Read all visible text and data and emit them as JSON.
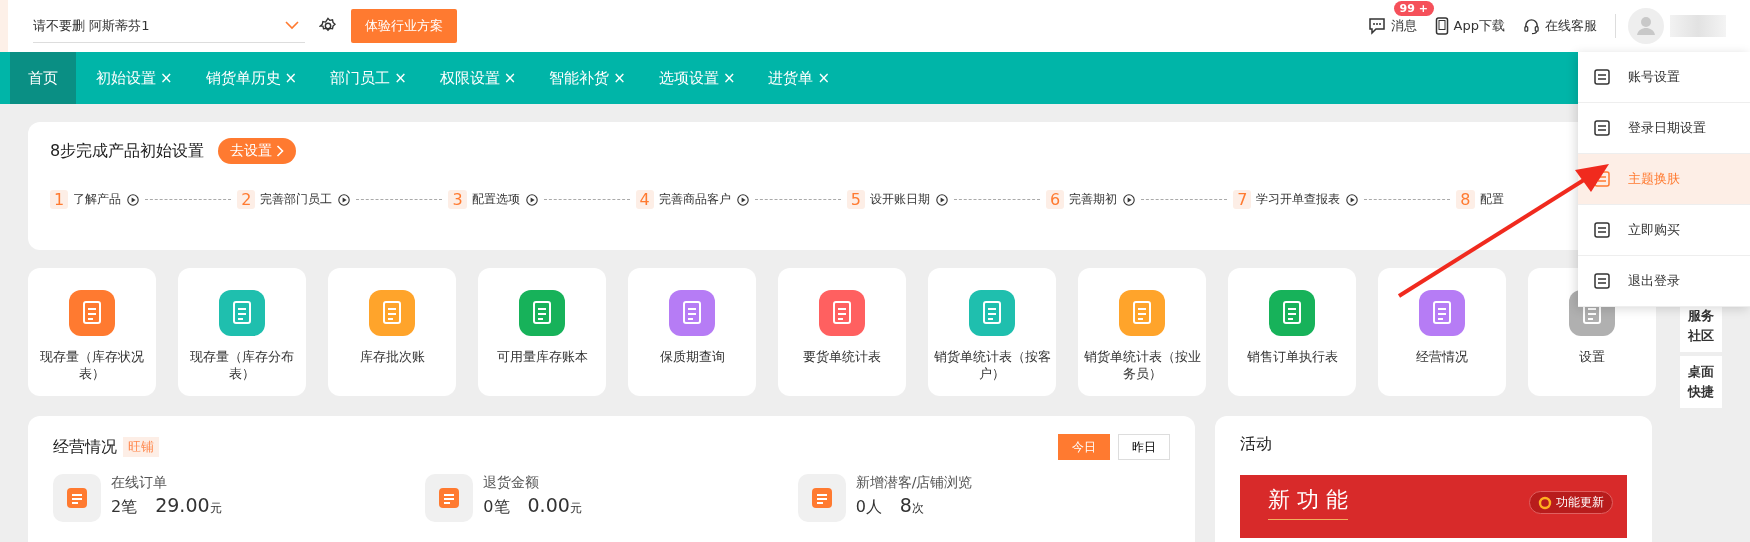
{
  "header": {
    "company": "请不要删 阿斯蒂芬1",
    "trial_button": "体验行业方案",
    "messages": {
      "label": "消息",
      "badge": "99 +"
    },
    "app_download": "App下载",
    "support": "在线客服"
  },
  "tabs": [
    {
      "label": "首页",
      "selected": true,
      "closable": false
    },
    {
      "label": "初始设置",
      "selected": false,
      "closable": true
    },
    {
      "label": "销货单历史",
      "selected": false,
      "closable": true
    },
    {
      "label": "部门员工",
      "selected": false,
      "closable": true
    },
    {
      "label": "权限设置",
      "selected": false,
      "closable": true
    },
    {
      "label": "智能补货",
      "selected": false,
      "closable": true
    },
    {
      "label": "选项设置",
      "selected": false,
      "closable": true
    },
    {
      "label": "进货单",
      "selected": false,
      "closable": true
    }
  ],
  "close_glyph": "×",
  "setup": {
    "title": "8步完成产品初始设置",
    "button": "去设置",
    "steps": [
      {
        "number": "1",
        "label": "了解产品"
      },
      {
        "number": "2",
        "label": "完善部门员工"
      },
      {
        "number": "3",
        "label": "配置选项"
      },
      {
        "number": "4",
        "label": "完善商品客户"
      },
      {
        "number": "5",
        "label": "设开账日期"
      },
      {
        "number": "6",
        "label": "完善期初"
      },
      {
        "number": "7",
        "label": "学习开单查报表"
      },
      {
        "number": "8",
        "label": "配置"
      }
    ]
  },
  "shortcuts": [
    {
      "label": "现存量（库存状况表）",
      "color": "#ff7a30"
    },
    {
      "label": "现存量（库存分布表）",
      "color": "#1fbfae"
    },
    {
      "label": "库存批次账",
      "color": "#ffa42b"
    },
    {
      "label": "可用量库存账本",
      "color": "#17b25a"
    },
    {
      "label": "保质期查询",
      "color": "#b67cf5"
    },
    {
      "label": "要货单统计表",
      "color": "#ff6060"
    },
    {
      "label": "销货单统计表（按客户）",
      "color": "#1fbfae"
    },
    {
      "label": "销货单统计表（按业务员）",
      "color": "#ffa42b"
    },
    {
      "label": "销售订单执行表",
      "color": "#17b25a"
    },
    {
      "label": "经营情况",
      "color": "#b67cf5"
    },
    {
      "label": "设置",
      "color": "#b0b0b0"
    }
  ],
  "business": {
    "title": "经营情况",
    "tag": "旺铺",
    "periods": [
      {
        "label": "今日",
        "selected": true
      },
      {
        "label": "昨日",
        "selected": false
      }
    ],
    "stats": [
      {
        "label": "在线订单",
        "count": "2笔",
        "amount": "29.00",
        "unit": "元"
      },
      {
        "label": "退货金额",
        "count": "0笔",
        "amount": "0.00",
        "unit": "元"
      },
      {
        "label": "新增潜客/店铺浏览",
        "count": "0人",
        "amount": "8",
        "unit": "次"
      }
    ]
  },
  "activity": {
    "title": "活动",
    "banner_title": "新 功 能",
    "banner_button": "功能更新"
  },
  "side_panel": [
    "服务社区",
    "桌面快捷"
  ],
  "user_menu": [
    {
      "label": "账号设置",
      "selected": false
    },
    {
      "label": "登录日期设置",
      "selected": false
    },
    {
      "label": "主题换肤",
      "selected": true
    },
    {
      "label": "立即购买",
      "selected": false
    },
    {
      "label": "退出登录",
      "selected": false
    }
  ]
}
